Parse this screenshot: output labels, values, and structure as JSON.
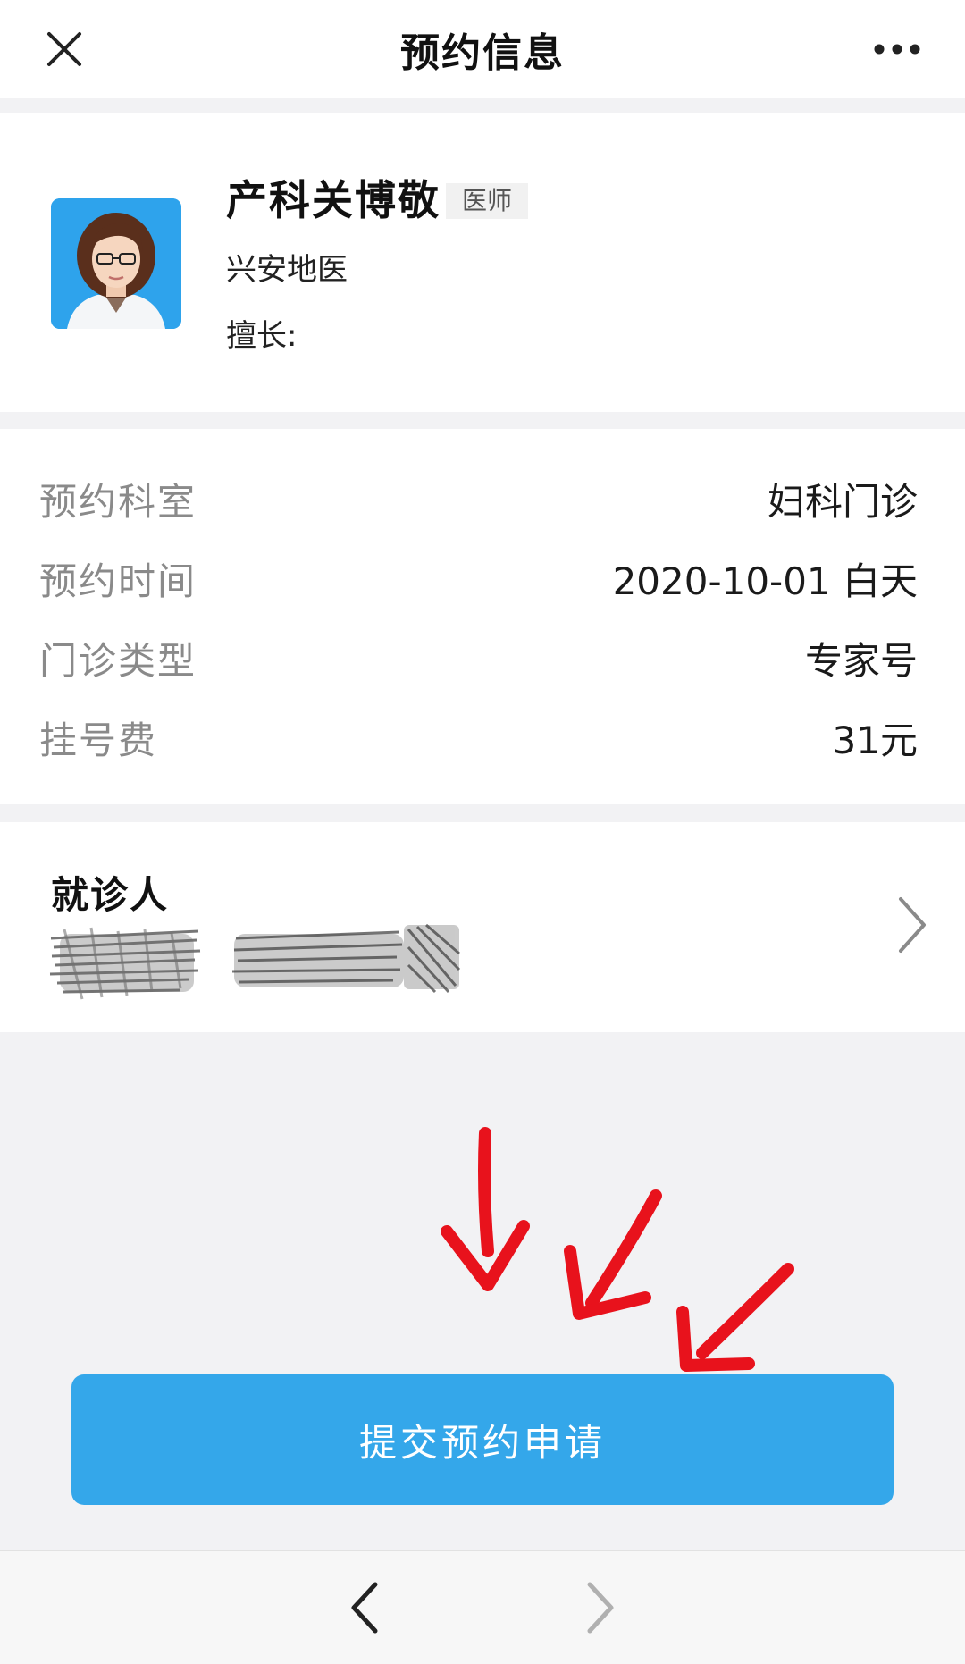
{
  "header": {
    "title": "预约信息",
    "close_icon": "close-icon",
    "more_icon": "more-dots-icon"
  },
  "doctor": {
    "name": "产科关博敬",
    "title_badge": "医师",
    "hospital": "兴安地医",
    "specialty_label": "擅长:",
    "avatar_icon": "doctor-avatar-photo"
  },
  "appointment": {
    "rows": [
      {
        "label": "预约科室",
        "value": "妇科门诊"
      },
      {
        "label": "预约时间",
        "value": "2020-10-01 白天"
      },
      {
        "label": "门诊类型",
        "value": "专家号"
      },
      {
        "label": "挂号费",
        "value": "31元"
      }
    ]
  },
  "patient": {
    "title": "就诊人",
    "chevron_icon": "chevron-right-icon"
  },
  "submit": {
    "label": "提交预约申请"
  },
  "browser_nav": {
    "back_icon": "chevron-left-icon",
    "forward_icon": "chevron-right-icon"
  },
  "colors": {
    "primary_button": "#34a7ea",
    "annotation_arrow": "#e8121c",
    "page_background": "#f2f2f4"
  }
}
